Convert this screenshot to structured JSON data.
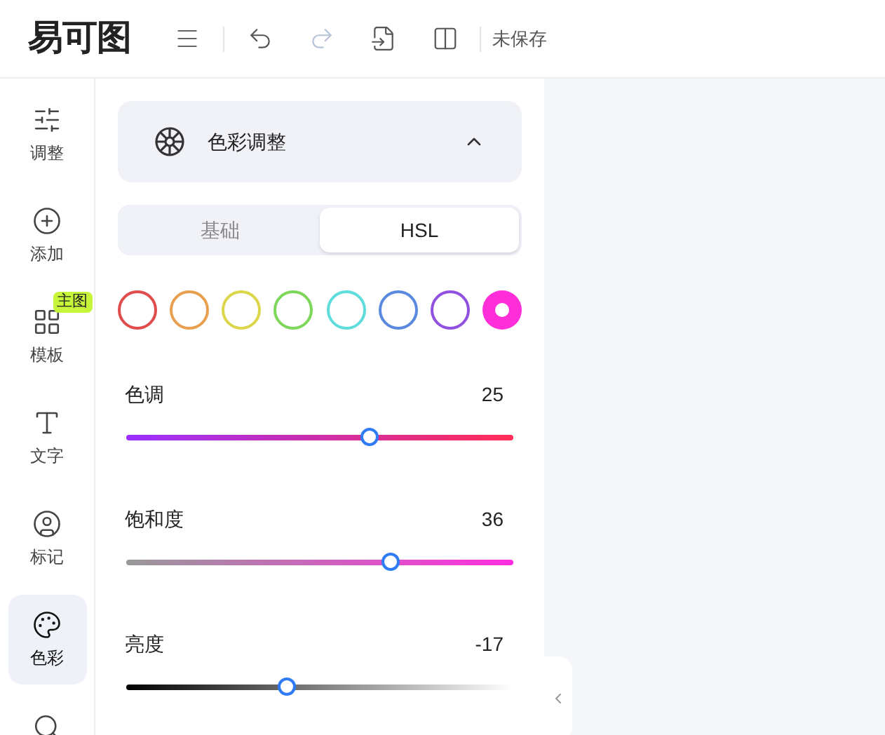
{
  "header": {
    "logo": "易可图",
    "undo_disabled": false,
    "redo_disabled": true,
    "status": "未保存"
  },
  "sidebar": {
    "items": [
      {
        "kind": "adjust",
        "label": "调整",
        "selected": false
      },
      {
        "kind": "add",
        "label": "添加",
        "selected": false
      },
      {
        "kind": "template",
        "label": "模板",
        "selected": false,
        "badge": "主图"
      },
      {
        "kind": "text",
        "label": "文字",
        "selected": false
      },
      {
        "kind": "mark",
        "label": "标记",
        "selected": false
      },
      {
        "kind": "color",
        "label": "色彩",
        "selected": true
      },
      {
        "kind": "search",
        "selected": false
      }
    ]
  },
  "panel": {
    "title": "色彩调整",
    "expanded": true,
    "tabs": [
      {
        "label": "基础",
        "selected": false
      },
      {
        "label": "HSL",
        "selected": true
      }
    ],
    "swatches": [
      {
        "color": "#e04b4b",
        "selected": false
      },
      {
        "color": "#e8a050",
        "selected": false
      },
      {
        "color": "#dcd64a",
        "selected": false
      },
      {
        "color": "#7ed65a",
        "selected": false
      },
      {
        "color": "#5fdcdc",
        "selected": false
      },
      {
        "color": "#5a8ae0",
        "selected": false
      },
      {
        "color": "#9050e0",
        "selected": false
      },
      {
        "color": "#ff2ed8",
        "selected": true
      }
    ],
    "sliders": [
      {
        "kind": "hue",
        "label": "色调",
        "reading": "25",
        "level": 0.625
      },
      {
        "kind": "saturation",
        "label": "饱和度",
        "reading": "36",
        "level": 0.68
      },
      {
        "kind": "brightness",
        "label": "亮度",
        "reading": "-17",
        "level": 0.415
      }
    ]
  }
}
